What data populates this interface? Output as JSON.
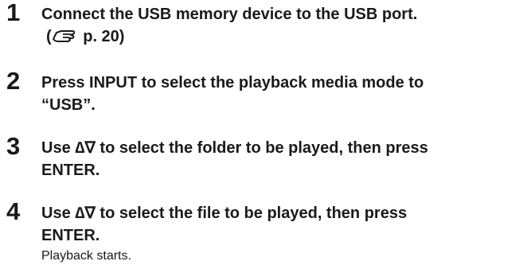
{
  "steps": [
    {
      "number": "1",
      "lines": [
        "Connect the USB memory device to the USB port."
      ],
      "reference": {
        "prefix": "(",
        "icon": "pointing-hand-icon",
        "text": " p. 20)"
      }
    },
    {
      "number": "2",
      "lines": [
        "Press INPUT to select the playback media mode to",
        "“USB”."
      ]
    },
    {
      "number": "3",
      "lines": [
        "Use ∆∇ to select the folder to be played, then press",
        "ENTER."
      ]
    },
    {
      "number": "4",
      "lines": [
        "Use ∆∇ to select the file to be played, then press",
        "ENTER."
      ],
      "result": "Playback starts."
    }
  ]
}
